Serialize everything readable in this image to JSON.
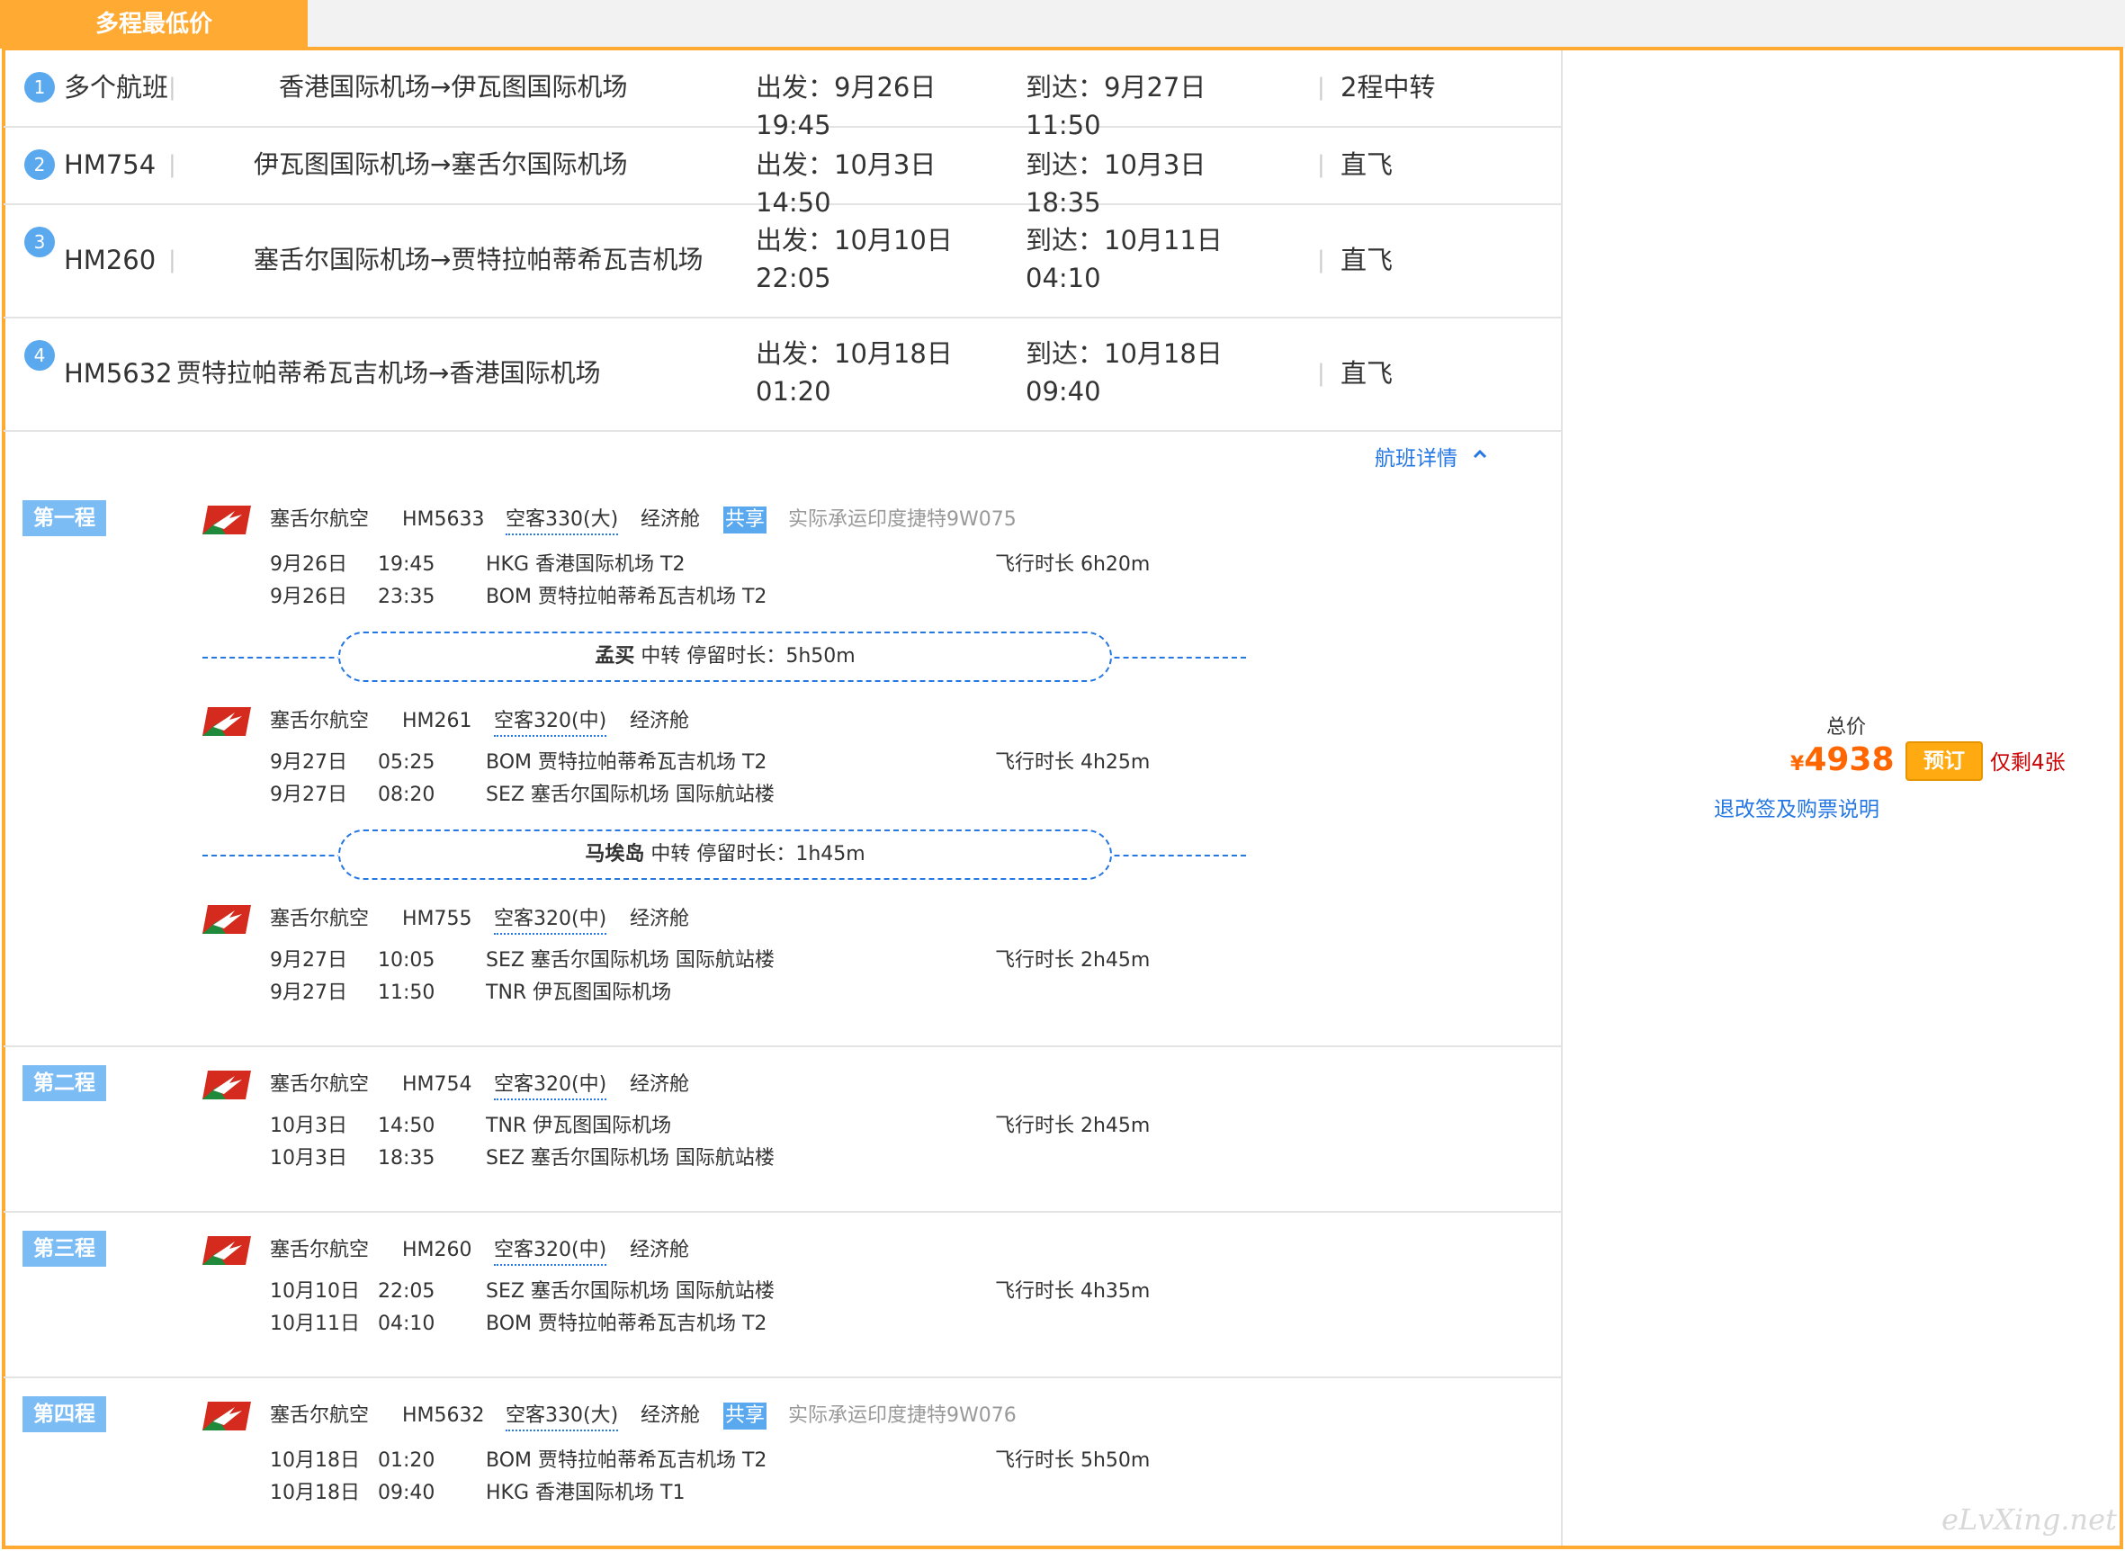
{
  "tab_title": "多程最低价",
  "summary": [
    {
      "num": "1",
      "flight": "多个航班",
      "route": "香港国际机场→伊瓦图国际机场",
      "dep": "出发：9月26日 19:45",
      "arr": "到达：9月27日 11:50",
      "type": "2程中转"
    },
    {
      "num": "2",
      "flight": "HM754",
      "route": "伊瓦图国际机场→塞舌尔国际机场",
      "dep": "出发：10月3日 14:50",
      "arr": "到达：10月3日 18:35",
      "type": "直飞"
    },
    {
      "num": "3",
      "flight": "HM260",
      "route": "塞舌尔国际机场→贾特拉帕蒂希瓦吉机场",
      "dep": "出发：10月10日 22:05",
      "arr": "到达：10月11日 04:10",
      "type": "直飞"
    },
    {
      "num": "4",
      "flight": "HM5632",
      "route": "贾特拉帕蒂希瓦吉机场→香港国际机场",
      "dep": "出发：10月18日 01:20",
      "arr": "到达：10月18日 09:40",
      "type": "直飞"
    }
  ],
  "separator": "|",
  "detail_link": "航班详情",
  "legs": [
    {
      "badge": "第一程",
      "segments": [
        {
          "airline": "塞舌尔航空",
          "flight": "HM5633",
          "aircraft": "空客330(大)",
          "cabin": "经济舱",
          "share": "共享",
          "operated": "实际承运印度捷特9W075",
          "dep_date": "9月26日",
          "dep_time": "19:45",
          "dep_airport": "HKG 香港国际机场 T2",
          "duration": "飞行时长 6h20m",
          "arr_date": "9月26日",
          "arr_time": "23:35",
          "arr_airport": "BOM 贾特拉帕蒂希瓦吉机场 T2"
        },
        {
          "airline": "塞舌尔航空",
          "flight": "HM261",
          "aircraft": "空客320(中)",
          "cabin": "经济舱",
          "dep_date": "9月27日",
          "dep_time": "05:25",
          "dep_airport": "BOM 贾特拉帕蒂希瓦吉机场 T2",
          "duration": "飞行时长 4h25m",
          "arr_date": "9月27日",
          "arr_time": "08:20",
          "arr_airport": "SEZ 塞舌尔国际机场 国际航站楼"
        },
        {
          "airline": "塞舌尔航空",
          "flight": "HM755",
          "aircraft": "空客320(中)",
          "cabin": "经济舱",
          "dep_date": "9月27日",
          "dep_time": "10:05",
          "dep_airport": "SEZ 塞舌尔国际机场 国际航站楼",
          "duration": "飞行时长 2h45m",
          "arr_date": "9月27日",
          "arr_time": "11:50",
          "arr_airport": "TNR 伊瓦图国际机场"
        }
      ],
      "transfers": [
        {
          "city": "孟买",
          "text": "中转 停留时长：5h50m"
        },
        {
          "city": "马埃岛",
          "text": "中转 停留时长：1h45m"
        }
      ]
    },
    {
      "badge": "第二程",
      "segments": [
        {
          "airline": "塞舌尔航空",
          "flight": "HM754",
          "aircraft": "空客320(中)",
          "cabin": "经济舱",
          "dep_date": "10月3日",
          "dep_time": "14:50",
          "dep_airport": "TNR 伊瓦图国际机场",
          "duration": "飞行时长 2h45m",
          "arr_date": "10月3日",
          "arr_time": "18:35",
          "arr_airport": "SEZ 塞舌尔国际机场 国际航站楼"
        }
      ]
    },
    {
      "badge": "第三程",
      "segments": [
        {
          "airline": "塞舌尔航空",
          "flight": "HM260",
          "aircraft": "空客320(中)",
          "cabin": "经济舱",
          "dep_date": "10月10日",
          "dep_time": "22:05",
          "dep_airport": "SEZ 塞舌尔国际机场 国际航站楼",
          "duration": "飞行时长 4h35m",
          "arr_date": "10月11日",
          "arr_time": "04:10",
          "arr_airport": "BOM 贾特拉帕蒂希瓦吉机场 T2"
        }
      ]
    },
    {
      "badge": "第四程",
      "segments": [
        {
          "airline": "塞舌尔航空",
          "flight": "HM5632",
          "aircraft": "空客330(大)",
          "cabin": "经济舱",
          "share": "共享",
          "operated": "实际承运印度捷特9W076",
          "dep_date": "10月18日",
          "dep_time": "01:20",
          "dep_airport": "BOM 贾特拉帕蒂希瓦吉机场 T2",
          "duration": "飞行时长 5h50m",
          "arr_date": "10月18日",
          "arr_time": "09:40",
          "arr_airport": "HKG 香港国际机场 T1"
        }
      ]
    }
  ],
  "price": {
    "label": "总价",
    "currency": "¥",
    "amount": "4938",
    "book_button": "预订",
    "remaining": "仅剩4张",
    "rules_link": "退改签及购票说明"
  },
  "watermark": "eLvXing.net",
  "colors": {
    "accent_orange": "#ffaa33",
    "price_orange": "#ff6600",
    "link_blue": "#2577e3",
    "badge_blue": "#7bbcf5",
    "remaining_red": "#cc0000"
  }
}
